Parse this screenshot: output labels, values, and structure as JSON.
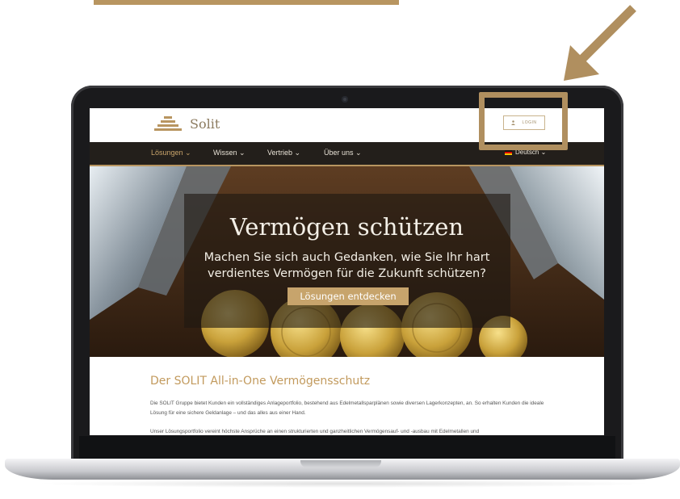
{
  "site": {
    "brand": "Solit",
    "login_label": "LOGIN"
  },
  "nav": {
    "items": [
      {
        "label": "Lösungen ⌄"
      },
      {
        "label": "Wissen ⌄"
      },
      {
        "label": "Vertrieb ⌄"
      },
      {
        "label": "Über uns ⌄"
      }
    ],
    "language": "Deutsch ⌄"
  },
  "hero": {
    "title": "Vermögen schützen",
    "subtitle_line1": "Machen Sie sich auch Gedanken, wie Sie Ihr hart",
    "subtitle_line2": "verdientes Vermögen für die Zukunft schützen?",
    "cta": "Lösungen entdecken"
  },
  "content": {
    "title": "Der SOLIT All-in-One Vermögensschutz",
    "paragraph1": "Die SOLIT Gruppe bietet Kunden ein vollständiges Anlageportfolio, bestehend aus Edelmetallsparplänen sowie diversen Lagerkonzepten, an. So erhalten Kunden die ideale Lösung für eine sichere Geldanlage – und das alles aus einer Hand.",
    "paragraph2": "Unser Lösungsportfolio vereint höchste Ansprüche an einen strukturierten und ganzheitlichen Vermögensauf- und -ausbau mit Edelmetallen und"
  },
  "colors": {
    "accent": "#b89560",
    "nav_bg": "#231f1b",
    "cta_bg": "#c7a46c"
  }
}
